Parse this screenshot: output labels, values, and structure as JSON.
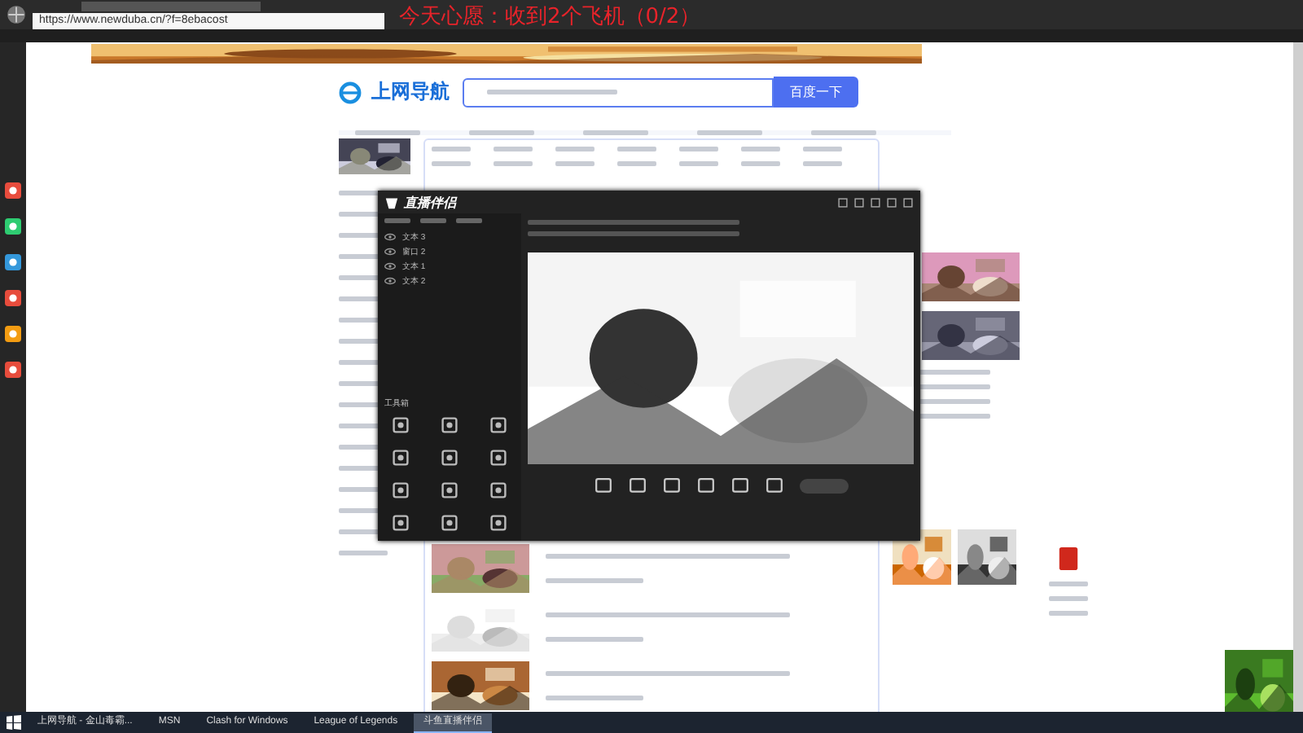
{
  "overlay_caption": "今天心愿：收到2个飞机（0/2）",
  "browser": {
    "url": "https://www.newduba.cn/?f=8ebacost"
  },
  "page": {
    "logo": "上网导航",
    "search_button": "百度一下"
  },
  "stream_app": {
    "title": "直播伴侣",
    "toolbox": "工具箱",
    "sources": [
      {
        "label": "文本 3"
      },
      {
        "label": "窗口 2"
      },
      {
        "label": "文本 1"
      },
      {
        "label": "文本 2"
      }
    ]
  },
  "taskbar": [
    {
      "label": "上网导航 - 金山毒霸...",
      "selected": false
    },
    {
      "label": "MSN",
      "selected": false
    },
    {
      "label": "Clash for Windows",
      "selected": false
    },
    {
      "label": "League of Legends",
      "selected": false
    },
    {
      "label": "斗鱼直播伴侣",
      "selected": true
    }
  ]
}
